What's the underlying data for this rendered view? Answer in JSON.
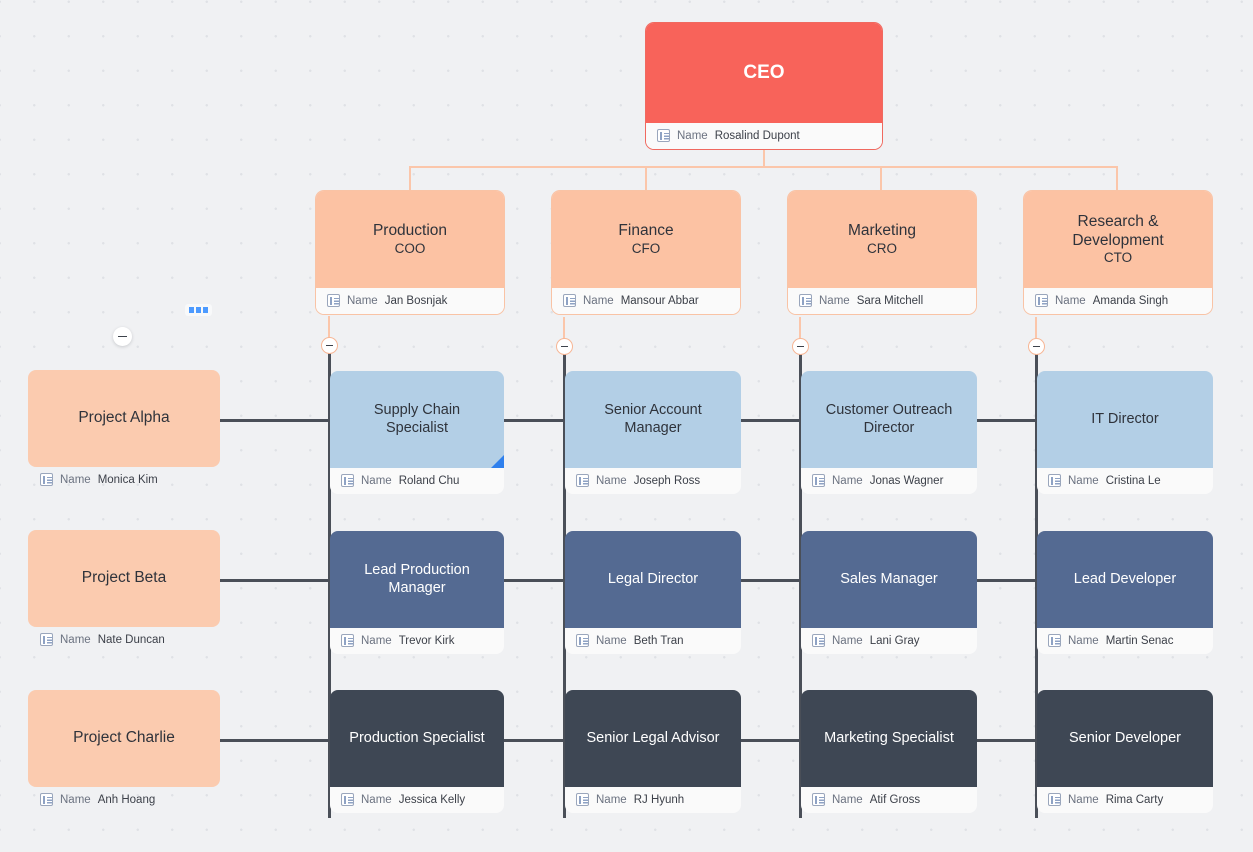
{
  "canvas": {
    "field_label": "Name",
    "record_icon": "record-list-icon",
    "accent_orange": "#fcc2a3",
    "accent_red": "#f8635a",
    "accent_blue_light": "#b3cfe6",
    "accent_blue_mid": "#546a92",
    "accent_dark": "#3e4754",
    "connector_orange": "#fbc6aa",
    "connector_dark": "#4a4f58",
    "background": "#f0f1f3"
  },
  "controls": {
    "more_options": "options-ellipsis",
    "collapse": "collapse-minus"
  },
  "nodes": {
    "ceo": {
      "title": "CEO",
      "role": "",
      "name": "Rosalind Dupont"
    },
    "production": {
      "title": "Production",
      "role": "COO",
      "name": "Jan Bosnjak"
    },
    "finance": {
      "title": "Finance",
      "role": "CFO",
      "name": "Mansour Abbar"
    },
    "marketing": {
      "title": "Marketing",
      "role": "CRO",
      "name": "Sara Mitchell"
    },
    "randd": {
      "title": "Research & Development",
      "role": "CTO",
      "name": "Amanda Singh"
    },
    "project_alpha": {
      "title": "Project Alpha",
      "name": "Monica Kim"
    },
    "project_beta": {
      "title": "Project Beta",
      "name": "Nate Duncan"
    },
    "project_charlie": {
      "title": "Project Charlie",
      "name": "Anh Hoang"
    },
    "supply_chain": {
      "title": "Supply Chain Specialist",
      "name": "Roland Chu"
    },
    "senior_account": {
      "title": "Senior Account Manager",
      "name": "Joseph Ross"
    },
    "customer_out": {
      "title": "Customer Outreach Director",
      "name": "Jonas Wagner"
    },
    "it_director": {
      "title": "IT Director",
      "name": "Cristina Le"
    },
    "lead_production": {
      "title": "Lead Production Manager",
      "name": "Trevor Kirk"
    },
    "legal_director": {
      "title": "Legal Director",
      "name": "Beth Tran"
    },
    "sales_manager": {
      "title": "Sales Manager",
      "name": "Lani Gray"
    },
    "lead_developer": {
      "title": "Lead Developer",
      "name": "Martin Senac"
    },
    "production_spec": {
      "title": "Production Specialist",
      "name": "Jessica Kelly"
    },
    "senior_legal": {
      "title": "Senior Legal Advisor",
      "name": "RJ Hyunh"
    },
    "marketing_spec": {
      "title": "Marketing  Specialist",
      "name": "Atif Gross"
    },
    "senior_dev": {
      "title": "Senior Developer",
      "name": "Rima Carty"
    }
  }
}
